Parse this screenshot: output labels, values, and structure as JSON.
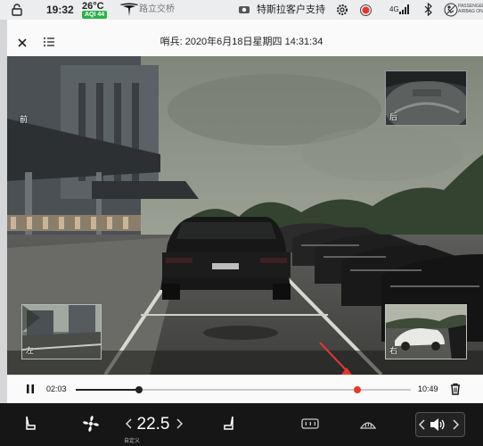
{
  "status_bar": {
    "time": "19:32",
    "temperature": "26°C",
    "aqi": "AQI 44",
    "road_name": "路立交桥",
    "support_label": "特斯拉客户支持",
    "network": "4G",
    "airbag_text": "PASSENGER AIRBAG ON",
    "icons": [
      "lock-icon",
      "tesla-logo",
      "camera-icon",
      "gear-icon",
      "record-icon",
      "signal-icon",
      "bluetooth-icon",
      "airbag-icon"
    ]
  },
  "viewer": {
    "title": "哨兵: 2020年6月18日星期四 14:31:34",
    "cameras": {
      "front": "前",
      "rear": "后",
      "left": "左",
      "right": "右"
    }
  },
  "playback": {
    "current_time": "02:03",
    "total_time": "10:49",
    "progress": 0.19,
    "event_marker": 0.84
  },
  "climate": {
    "temperature": "22.5",
    "temp_mode": "自定义",
    "icons": [
      "seat-heater-left-icon",
      "fan-icon",
      "temp-down-icon",
      "temp-up-icon",
      "seat-heater-right-icon",
      "rear-defrost-icon",
      "volume-down-icon",
      "volume-icon",
      "volume-up-icon"
    ]
  },
  "colors": {
    "accent_red": "#e8382d",
    "aqi_green": "#2bb24c"
  }
}
